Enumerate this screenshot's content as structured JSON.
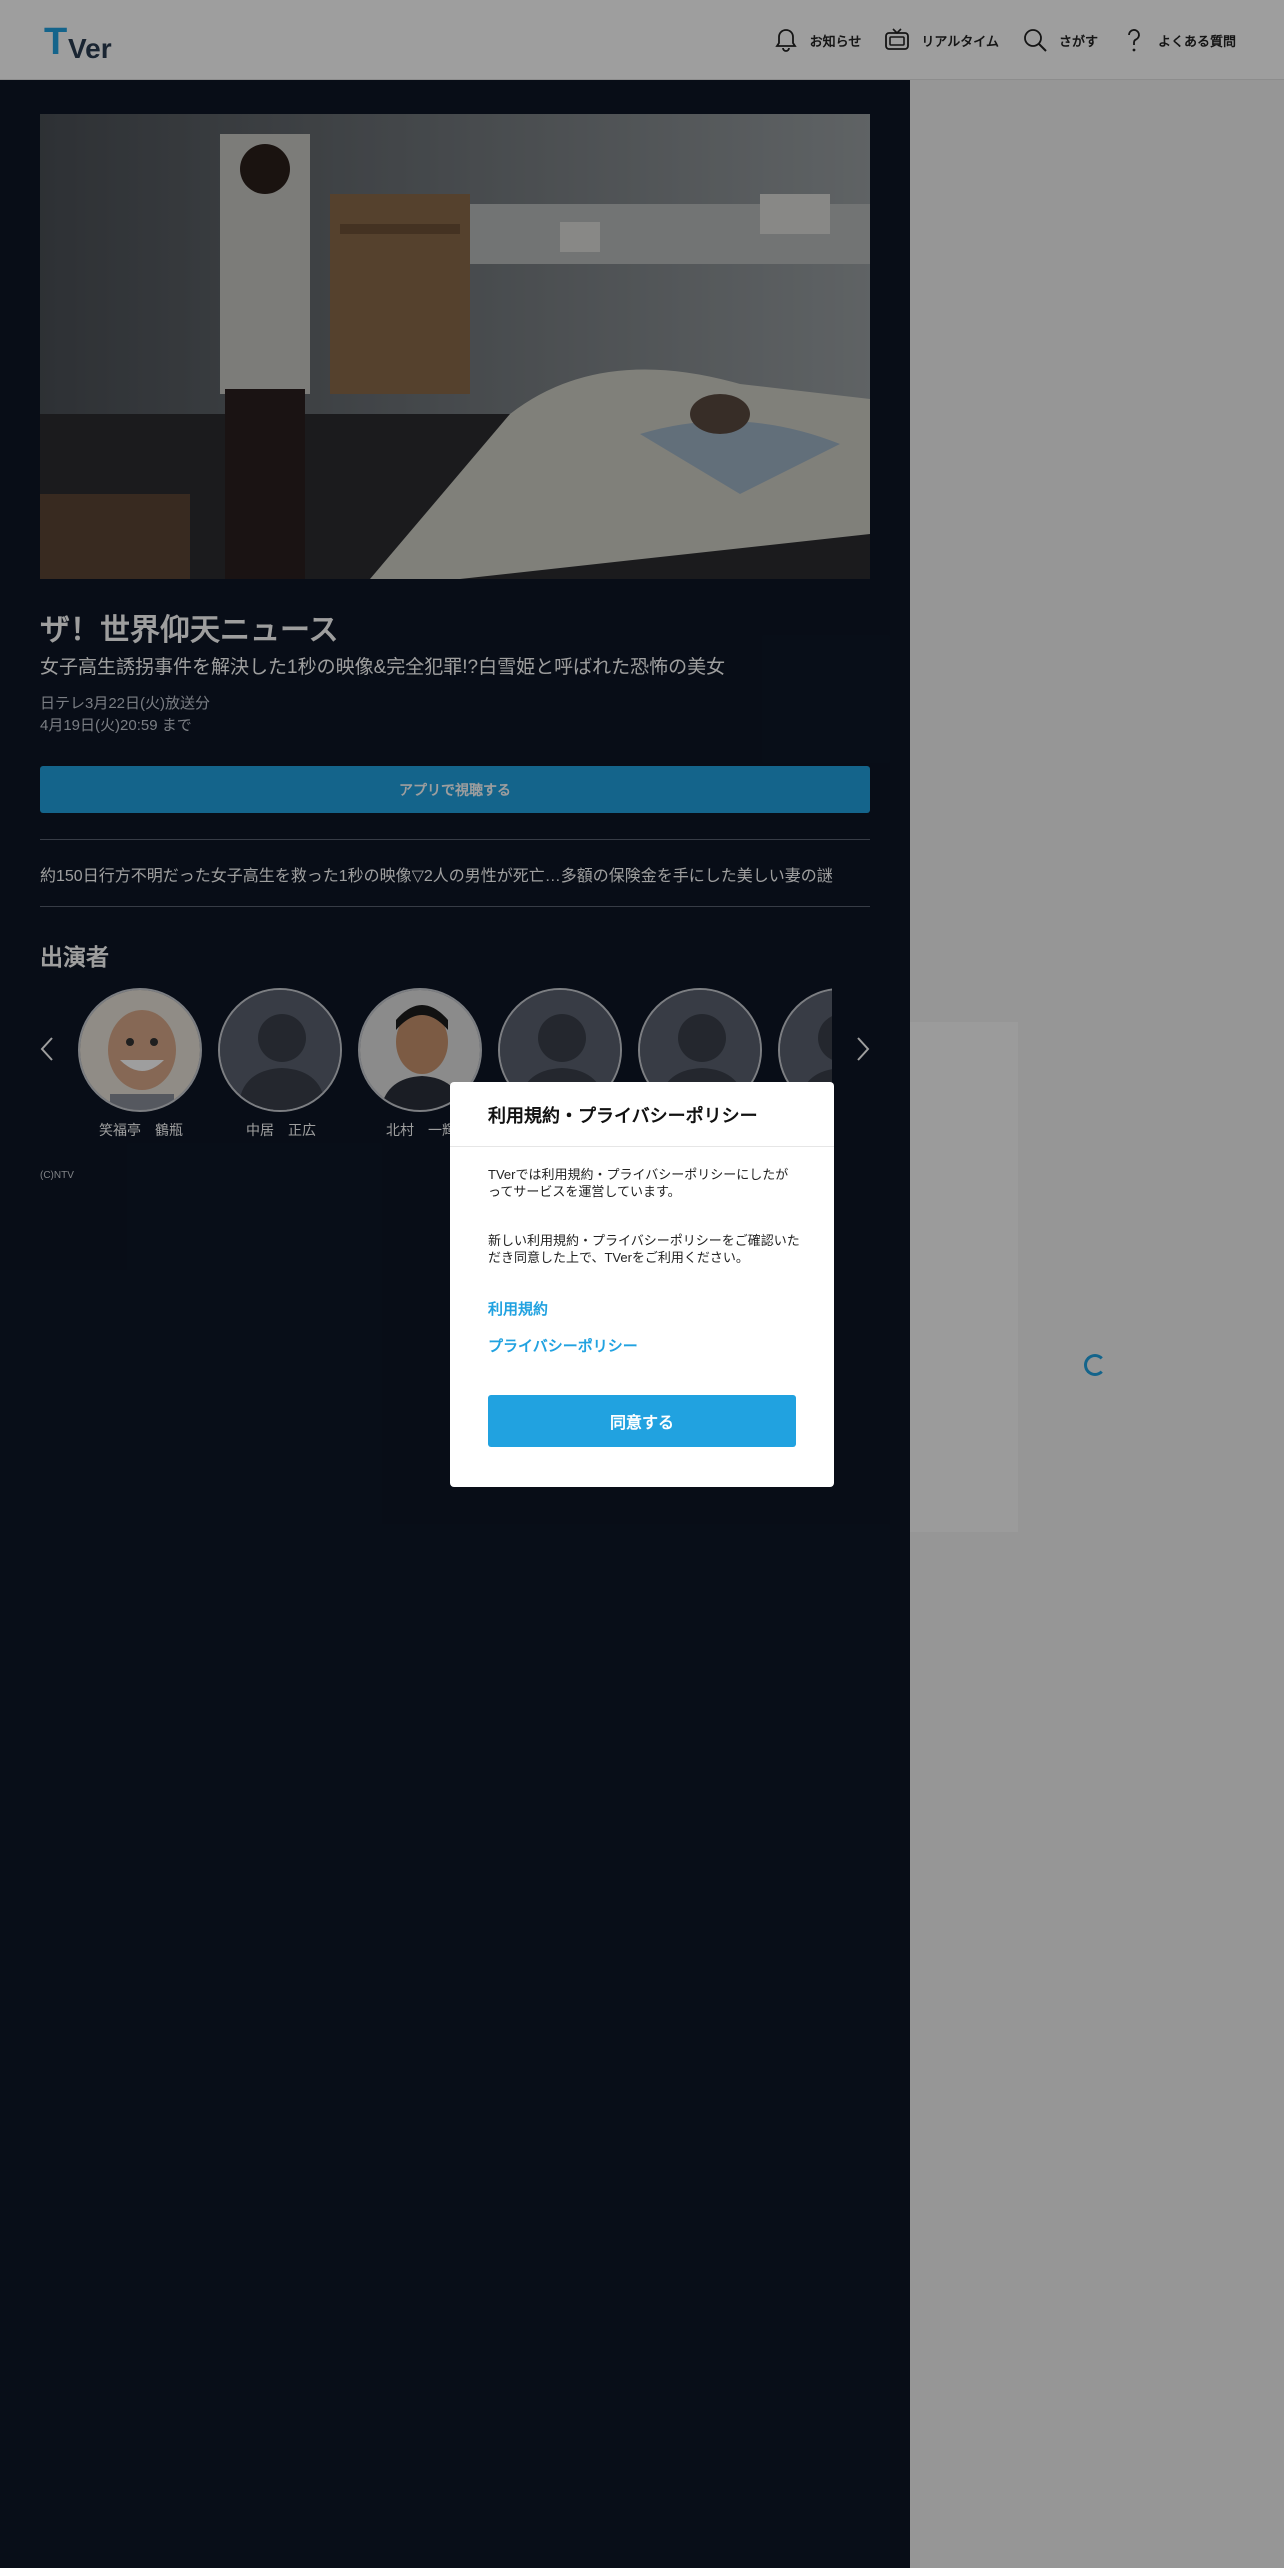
{
  "header": {
    "logo_text": "TVer",
    "nav": [
      {
        "label": "お知らせ",
        "icon": "bell-icon"
      },
      {
        "label": "リアルタイム",
        "icon": "tv-icon"
      },
      {
        "label": "さがす",
        "icon": "search-icon"
      },
      {
        "label": "よくある質問",
        "icon": "question-icon"
      }
    ]
  },
  "episode": {
    "title": "ザ！世界仰天ニュース",
    "subtitle": "女子高生誘拐事件を解決した1秒の映像&完全犯罪!?白雪姫と呼ばれた恐怖の美女",
    "broadcast": "日テレ3月22日(火)放送分",
    "available_until": "4月19日(火)20:59 まで",
    "app_button": "アプリで視聴する",
    "description": "約150日行方不明だった女子高生を救った1秒の映像▽2人の男性が死亡…多額の保険金を手にした美しい妻の謎",
    "copyright": "(C)NTV"
  },
  "cast": {
    "heading": "出演者",
    "members": [
      {
        "name": "笑福亭　鶴瓶",
        "photo": "portrait"
      },
      {
        "name": "中居　正広",
        "photo": "placeholder"
      },
      {
        "name": "北村　一輝",
        "photo": "portrait"
      },
      {
        "name": "",
        "photo": "placeholder"
      },
      {
        "name": "",
        "photo": "placeholder"
      },
      {
        "name": "",
        "photo": "placeholder"
      }
    ]
  },
  "modal": {
    "title": "利用規約・プライバシーポリシー",
    "paragraph1": "TVerでは利用規約・プライバシーポリシーにしたがってサービスを運営しています。",
    "paragraph2": "新しい利用規約・プライバシーポリシーをご確認いただき同意した上で、TVerをご利用ください。",
    "link_terms": "利用規約",
    "link_privacy": "プライバシーポリシー",
    "agree_button": "同意する"
  },
  "colors": {
    "accent": "#21a2e0",
    "dark_bg": "#0d1626"
  }
}
